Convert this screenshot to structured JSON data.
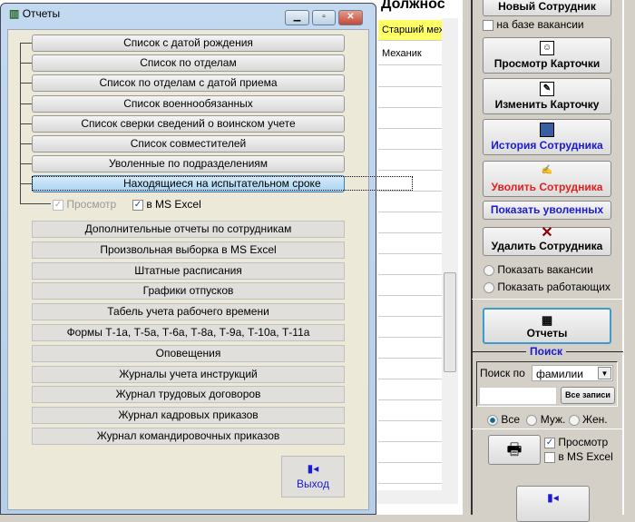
{
  "background": {
    "column_header": "Должнос",
    "rows": [
      "Старший мех",
      "Механик"
    ],
    "highlight_color": "#ffff66"
  },
  "right_panel": {
    "new_employee": "Новый Сотрудник",
    "based_on_vacancy": "на базе вакансии",
    "view_card": "Просмотр Карточки",
    "edit_card": "Изменить Карточку",
    "history": "История Сотрудника",
    "dismiss": "Уволить Сотрудника",
    "show_dismissed": "Показать уволенных",
    "delete": "Удалить Сотрудника",
    "show_vacancies": "Показать вакансии",
    "show_working": "Показать работающих",
    "reports": "Отчеты",
    "search": {
      "title": "Поиск",
      "label": "Поиск по",
      "field": "фамилии",
      "value": "",
      "all_records": "Все записи"
    },
    "gender": {
      "all": "Все",
      "male": "Муж.",
      "female": "Жен.",
      "selected": "all"
    },
    "print": {
      "preview": "Просмотр",
      "preview_checked": true,
      "excel": "в MS Excel",
      "excel_checked": false
    }
  },
  "dialog": {
    "title": "Отчеты",
    "group1": [
      "Список с датой рождения",
      "Список по отделам",
      "Список по отделам с датой приема",
      "Список военнообязанных",
      "Список сверки сведений о воинском учете",
      "Список совместителей",
      "Уволенные по подразделениям",
      "Находящиеся на испытательном сроке"
    ],
    "selected_index": 7,
    "preview": "Просмотр",
    "preview_checked": true,
    "preview_disabled": true,
    "excel": "в MS Excel",
    "excel_checked": true,
    "group2": [
      "Дополнительные отчеты по сотрудникам",
      "Произвольная выборка в MS Excel",
      "Штатные расписания",
      "Графики отпусков",
      "Табель учета рабочего времени",
      "Формы Т-1а, Т-5а, Т-6а, Т-8а, Т-9а, Т-10а, Т-11а",
      "Оповещения",
      "Журналы учета инструкций",
      "Журнал трудовых договоров",
      "Журнал кадровых приказов",
      "Журнал командировочных приказов"
    ],
    "exit": "Выход"
  }
}
